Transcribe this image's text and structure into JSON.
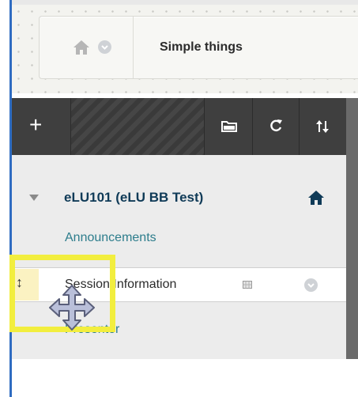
{
  "breadcrumb": {
    "title": "Simple things"
  },
  "toolbar": {
    "add_label": "+"
  },
  "course_menu": {
    "course_title": "eLU101 (eLU BB Test)",
    "items": [
      {
        "label": "Announcements"
      },
      {
        "label": "Session Information"
      },
      {
        "label": "Presenter"
      }
    ]
  },
  "colors": {
    "toolbar_bg": "#3f3f3f",
    "link_color": "#2d7d8c",
    "highlight": "#f2ee3e"
  }
}
